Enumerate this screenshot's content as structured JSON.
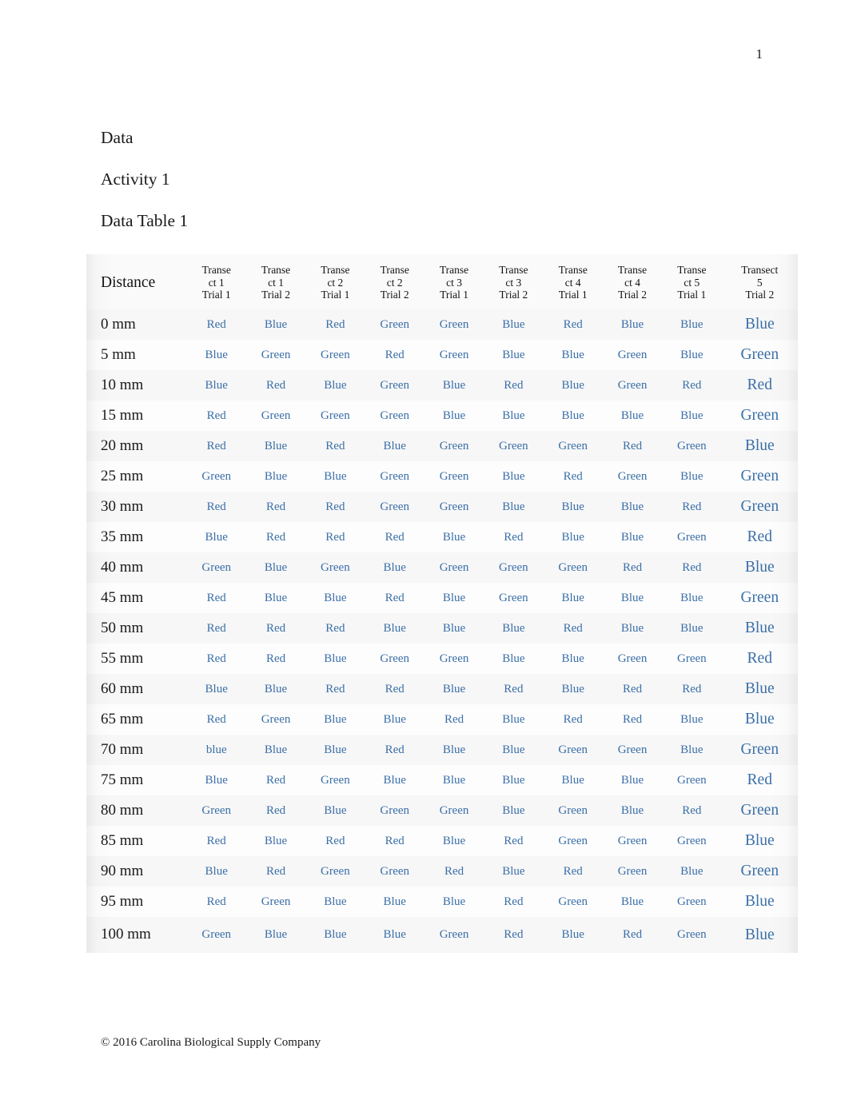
{
  "document": {
    "page_number": "1",
    "footer": "© 2016 Carolina Biological Supply Company",
    "text_color": "#1a1a1a",
    "cell_color": "#3b6fa8"
  },
  "headings": [
    {
      "text": "Data"
    },
    {
      "text": "Activity 1"
    },
    {
      "text": "Data Table 1"
    }
  ],
  "table": {
    "distance_header": "Distance",
    "columns": [
      "Transect 1 Trial 1",
      "Transect 1 Trial 2",
      "Transect 2 Trial 1",
      "Transect 2 Trial 2",
      "Transect 3 Trial 1",
      "Transect 3 Trial 2",
      "Transect 4 Trial 1",
      "Transect 4 Trial 2",
      "Transect 5 Trial 1",
      "Transect 5 Trial 2"
    ],
    "column_headers": [
      {
        "line1": "Transe",
        "line2": "ct 1",
        "line3": "Trial 1"
      },
      {
        "line1": "Transe",
        "line2": "ct 1",
        "line3": "Trial 2"
      },
      {
        "line1": "Transe",
        "line2": "ct 2",
        "line3": "Trial 1"
      },
      {
        "line1": "Transe",
        "line2": "ct 2",
        "line3": "Trial 2"
      },
      {
        "line1": "Transe",
        "line2": "ct 3",
        "line3": "Trial 1"
      },
      {
        "line1": "Transe",
        "line2": "ct 3",
        "line3": "Trial 2"
      },
      {
        "line1": "Transe",
        "line2": "ct 4",
        "line3": "Trial 1"
      },
      {
        "line1": "Transe",
        "line2": "ct 4",
        "line3": "Trial 2"
      },
      {
        "line1": "Transe",
        "line2": "ct 5",
        "line3": "Trial 1"
      },
      {
        "line1": "Transect",
        "line2": "5",
        "line3": "Trial 2"
      }
    ],
    "rows": [
      {
        "distance": "0 mm",
        "values": [
          "Red",
          "Blue",
          "Red",
          "Green",
          "Green",
          "Blue",
          "Red",
          "Blue",
          "Blue",
          "Blue"
        ]
      },
      {
        "distance": "5 mm",
        "values": [
          "Blue",
          "Green",
          "Green",
          "Red",
          "Green",
          "Blue",
          "Blue",
          "Green",
          "Blue",
          "Green"
        ]
      },
      {
        "distance": "10 mm",
        "values": [
          "Blue",
          "Red",
          "Blue",
          "Green",
          "Blue",
          "Red",
          "Blue",
          "Green",
          "Red",
          "Red"
        ]
      },
      {
        "distance": "15 mm",
        "values": [
          "Red",
          "Green",
          "Green",
          "Green",
          "Blue",
          "Blue",
          "Blue",
          "Blue",
          "Blue",
          "Green"
        ]
      },
      {
        "distance": "20 mm",
        "values": [
          "Red",
          "Blue",
          "Red",
          "Blue",
          "Green",
          "Green",
          "Green",
          "Red",
          "Green",
          "Blue"
        ]
      },
      {
        "distance": "25 mm",
        "values": [
          "Green",
          "Blue",
          "Blue",
          "Green",
          "Green",
          "Blue",
          "Red",
          "Green",
          "Blue",
          "Green"
        ]
      },
      {
        "distance": "30 mm",
        "values": [
          "Red",
          "Red",
          "Red",
          "Green",
          "Green",
          "Blue",
          "Blue",
          "Blue",
          "Red",
          "Green"
        ]
      },
      {
        "distance": "35 mm",
        "values": [
          "Blue",
          "Red",
          "Red",
          "Red",
          "Blue",
          "Red",
          "Blue",
          "Blue",
          "Green",
          "Red"
        ]
      },
      {
        "distance": "40 mm",
        "values": [
          "Green",
          "Blue",
          "Green",
          "Blue",
          "Green",
          "Green",
          "Green",
          "Red",
          "Red",
          "Blue"
        ]
      },
      {
        "distance": "45 mm",
        "values": [
          "Red",
          "Blue",
          "Blue",
          "Red",
          "Blue",
          "Green",
          "Blue",
          "Blue",
          "Blue",
          "Green"
        ]
      },
      {
        "distance": "50 mm",
        "values": [
          "Red",
          "Red",
          "Red",
          "Blue",
          "Blue",
          "Blue",
          "Red",
          "Blue",
          "Blue",
          "Blue"
        ]
      },
      {
        "distance": "55 mm",
        "values": [
          "Red",
          "Red",
          "Blue",
          "Green",
          "Green",
          "Blue",
          "Blue",
          "Green",
          "Green",
          "Red"
        ]
      },
      {
        "distance": "60 mm",
        "values": [
          "Blue",
          "Blue",
          "Red",
          "Red",
          "Blue",
          "Red",
          "Blue",
          "Red",
          "Red",
          "Blue"
        ]
      },
      {
        "distance": "65 mm",
        "values": [
          "Red",
          "Green",
          "Blue",
          "Blue",
          "Red",
          "Blue",
          "Red",
          "Red",
          "Blue",
          "Blue"
        ]
      },
      {
        "distance": "70 mm",
        "values": [
          "blue",
          "Blue",
          "Blue",
          "Red",
          "Blue",
          "Blue",
          "Green",
          "Green",
          "Blue",
          "Green"
        ]
      },
      {
        "distance": "75 mm",
        "values": [
          "Blue",
          "Red",
          "Green",
          "Blue",
          "Blue",
          "Blue",
          "Blue",
          "Blue",
          "Green",
          "Red"
        ]
      },
      {
        "distance": "80 mm",
        "values": [
          "Green",
          "Red",
          "Blue",
          "Green",
          "Green",
          "Blue",
          "Green",
          "Blue",
          "Red",
          "Green"
        ]
      },
      {
        "distance": "85 mm",
        "values": [
          "Red",
          "Blue",
          "Red",
          "Red",
          "Blue",
          "Red",
          "Green",
          "Green",
          "Green",
          "Blue"
        ]
      },
      {
        "distance": "90 mm",
        "values": [
          "Blue",
          "Red",
          "Green",
          "Green",
          "Red",
          "Blue",
          "Red",
          "Green",
          "Blue",
          "Green"
        ]
      },
      {
        "distance": "95 mm",
        "values": [
          "Red",
          "Green",
          "Blue",
          "Blue",
          "Blue",
          "Red",
          "Green",
          "Blue",
          "Green",
          "Blue"
        ]
      },
      {
        "distance": "100 mm",
        "values": [
          "Green",
          "Blue",
          "Blue",
          "Blue",
          "Green",
          "Red",
          "Blue",
          "Red",
          "Green",
          "Blue"
        ]
      }
    ]
  }
}
